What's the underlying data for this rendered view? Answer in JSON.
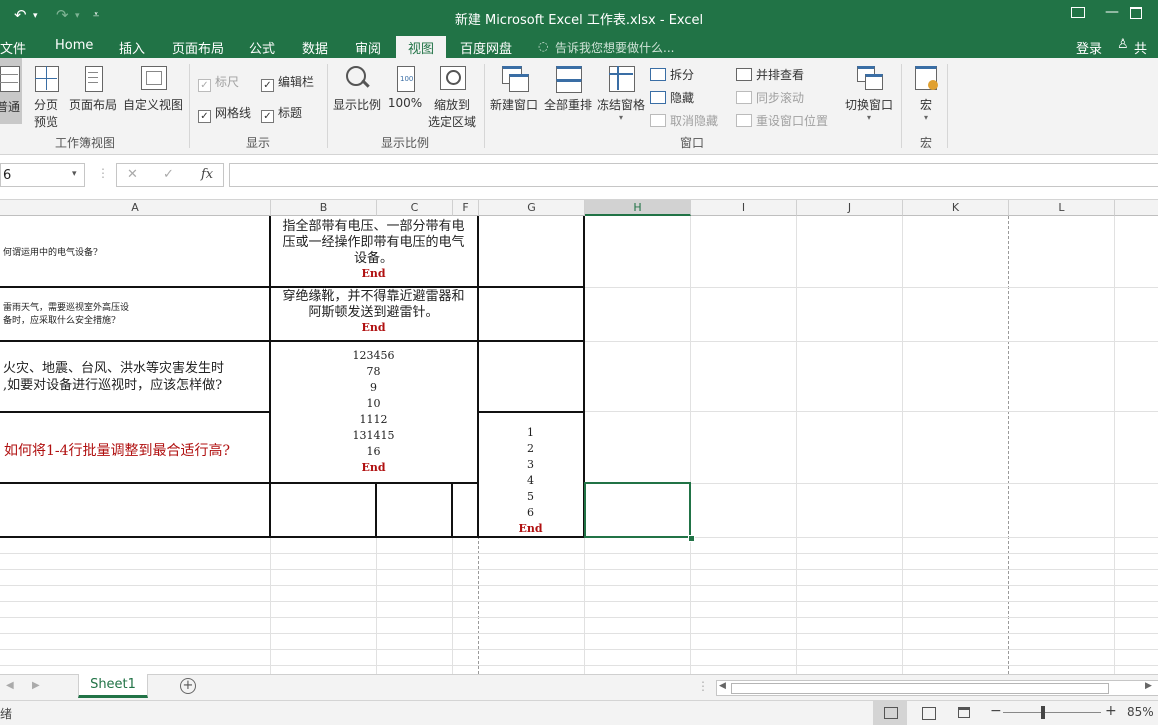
{
  "window": {
    "title": "新建 Microsoft Excel 工作表.xlsx - Excel"
  },
  "tabs": [
    "文件",
    "Home",
    "插入",
    "页面布局",
    "公式",
    "数据",
    "审阅",
    "视图",
    "百度网盘"
  ],
  "active_tab": "视图",
  "tell_me": "告诉我您想要做什么...",
  "login": "登录",
  "share": "共享",
  "ribbon": {
    "workbook_views": {
      "label": "工作簿视图",
      "normal": "普通",
      "page_break_1": "分页",
      "page_break_2": "预览",
      "page_layout": "页面布局",
      "custom_view": "自定义视图"
    },
    "show": {
      "label": "显示",
      "ruler": "标尺",
      "formula_bar": "编辑栏",
      "gridlines": "网格线",
      "headings": "标题"
    },
    "zoom": {
      "label": "显示比例",
      "zoom": "显示比例",
      "hundred": "100%",
      "zoom_sel_1": "缩放到",
      "zoom_sel_2": "选定区域"
    },
    "window": {
      "label": "窗口",
      "new_window": "新建窗口",
      "arrange_all": "全部重排",
      "freeze_panes": "冻结窗格",
      "split": "拆分",
      "hide": "隐藏",
      "unhide": "取消隐藏",
      "side_by_side": "并排查看",
      "sync_scroll": "同步滚动",
      "reset_position": "重设窗口位置",
      "switch_windows": "切换窗口"
    },
    "macros": {
      "label": "宏",
      "macros": "宏"
    }
  },
  "formula_bar": {
    "name_box": "6",
    "fx": "fx",
    "cancel": "✕",
    "enter": "✓"
  },
  "columns": [
    "A",
    "B",
    "C",
    "F",
    "G",
    "H",
    "I",
    "J",
    "K",
    "L"
  ],
  "selected_column": "H",
  "cells": {
    "a1": "何谓运用中的电气设备?",
    "b1_lines": [
      "指全部带有电压、一部分带有电",
      "压或一经操作即带有电压的电气",
      "设备。"
    ],
    "end": "End",
    "a2_lines": [
      "雷雨天气，需要巡视室外高压设",
      "备时，应采取什么安全措施?"
    ],
    "b2_lines": [
      "穿绝缘靴，并不得靠近避雷器和",
      "阿斯顿发送到避雷针。"
    ],
    "a3_lines": [
      "火灾、地震、台风、洪水等灾害发生时",
      ",如要对设备进行巡视时，应该怎样做?"
    ],
    "b3_values": [
      "123456",
      "78",
      "9",
      "10",
      "1112",
      "131415",
      "16"
    ],
    "a4": "如何将1-4行批量调整到最合适行高?",
    "g_values": [
      "1",
      "2",
      "3",
      "4",
      "5",
      "6"
    ]
  },
  "sheet_tab": "Sheet1",
  "status": {
    "left": "绪",
    "zoom": "85%"
  },
  "colors": {
    "accent": "#217346",
    "end_red": "#b01010",
    "a4_red": "#b01010"
  }
}
